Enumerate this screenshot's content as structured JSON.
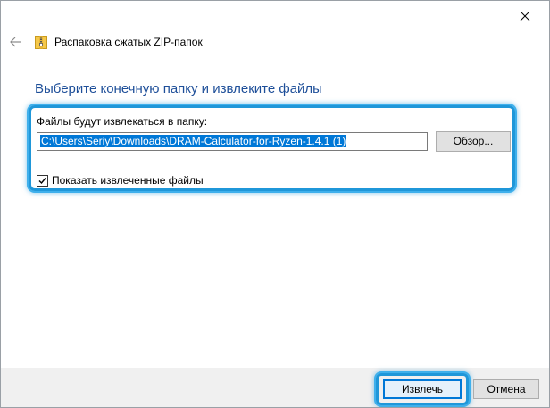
{
  "window": {
    "title": "Распаковка сжатых ZIP-папок"
  },
  "page": {
    "heading": "Выберите конечную папку и извлеките файлы",
    "folder_label": "Файлы будут извлекаться в папку:",
    "path_value": "C:\\Users\\Seriy\\Downloads\\DRAM-Calculator-for-Ryzen-1.4.1 (1)",
    "browse_label": "Обзор...",
    "show_files_label": "Показать извлеченные файлы",
    "show_files_checked": true
  },
  "footer": {
    "extract_label": "Извлечь",
    "cancel_label": "Отмена"
  },
  "icons": {
    "close": "close-icon",
    "back": "back-arrow-icon",
    "zip": "zip-folder-icon",
    "checkmark": "checkmark-icon"
  },
  "colors": {
    "heading": "#1e4f99",
    "highlight": "#1f97d9",
    "selection": "#0078d7",
    "footer_bg": "#f0f0f0"
  }
}
